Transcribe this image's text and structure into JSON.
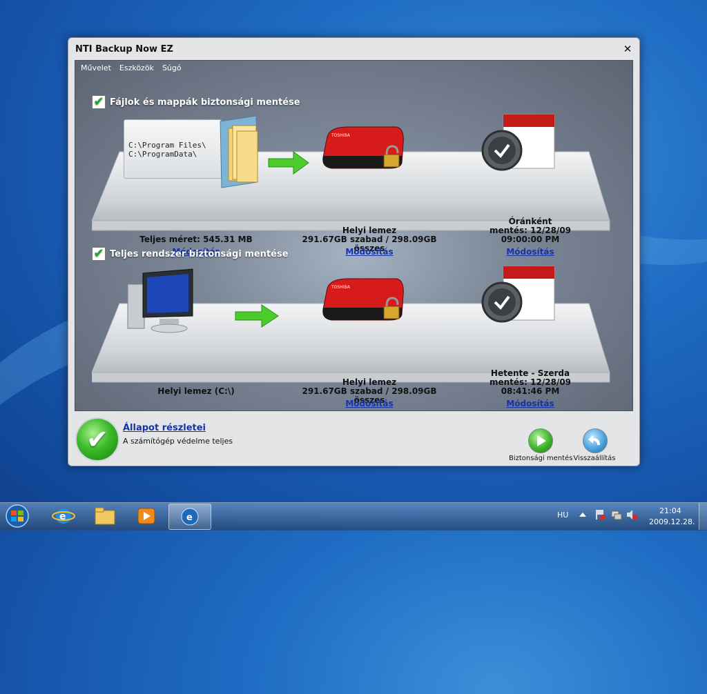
{
  "window": {
    "title": "NTI Backup Now EZ"
  },
  "menu": [
    {
      "label": "Művelet"
    },
    {
      "label": "Eszközök"
    },
    {
      "label": "Súgó"
    }
  ],
  "files_section": {
    "title": "Fájlok és mappák biztonsági mentése",
    "paths": [
      "C:\\Program Files\\",
      "C:\\ProgramData\\"
    ],
    "size_label": "Teljes méret: 545.31 MB",
    "modify_label": "Módosítás",
    "destination": {
      "name": "Helyi lemez",
      "capacity": "291.67GB szabad / 298.09GB összes",
      "modify_label": "Módosítás"
    },
    "schedule": {
      "frequency": "Óránként",
      "line2": "mentés: 12/28/09",
      "time": "09:00:00 PM",
      "modify_label": "Módosítás"
    }
  },
  "system_section": {
    "title": "Teljes rendszer biztonsági mentése",
    "source": "Helyi lemez (C:\\)",
    "destination": {
      "name": "Helyi lemez",
      "capacity": "291.67GB szabad / 298.09GB összes",
      "modify_label": "Módosítás"
    },
    "schedule": {
      "frequency": "Hetente - Szerda",
      "line2": "mentés: 12/28/09",
      "time": "08:41:46 PM",
      "modify_label": "Módosítás"
    }
  },
  "status": {
    "link": "Állapot részletei",
    "text": "A számítógép védelme teljes"
  },
  "actions": {
    "backup_label": "Biztonsági mentés",
    "restore_label": "Visszaállítás"
  },
  "drive_brand": "TOSHIBA",
  "taskbar": {
    "lang": "HU",
    "time": "21:04",
    "date": "2009.12.28."
  }
}
